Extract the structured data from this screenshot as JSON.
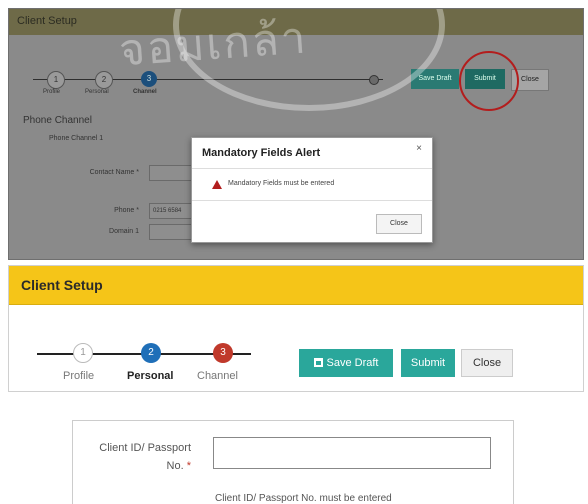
{
  "top_panel": {
    "window_title": "Client Setup",
    "steps": [
      "Profile",
      "Personal",
      "Channel"
    ],
    "step_numbers": [
      "1",
      "2",
      "3"
    ],
    "save_draft_label": "Save Draft",
    "submit_label": "Submit",
    "close_label": "Close",
    "section_title": "Phone Channel",
    "phone_channel_label": "Phone Channel 1",
    "contact_name_label": "Contact Name *",
    "phone_label": "Phone *",
    "phone_value": "0215 6584",
    "domain_label": "Domain 1",
    "modal": {
      "title": "Mandatory Fields Alert",
      "close_x": "×",
      "message": "Mandatory Fields must be entered",
      "close_button": "Close"
    },
    "watermark_text": "จอมเกล้า"
  },
  "client_setup": {
    "title": "Client Setup",
    "steps": [
      {
        "number": "1",
        "label": "Profile"
      },
      {
        "number": "2",
        "label": "Personal"
      },
      {
        "number": "3",
        "label": "Channel"
      }
    ],
    "save_draft_label": "Save Draft",
    "submit_label": "Submit",
    "close_label": "Close",
    "colors": {
      "header": "#f5c518",
      "accent": "#2aa79b",
      "step_active": "#1f6fb8",
      "step_next": "#c0392b"
    }
  },
  "client_id_form": {
    "label_line1": "Client ID/ Passport",
    "label_line2": "No.",
    "required_mark": "*",
    "input_value": "",
    "error_message": "Client ID/ Passport No. must be entered"
  }
}
